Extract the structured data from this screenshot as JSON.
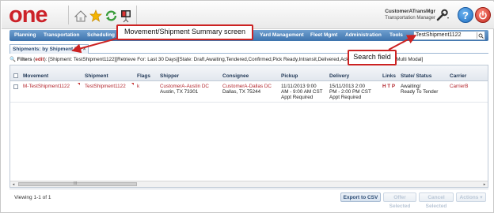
{
  "header": {
    "logo": "one",
    "user_name": "CustomerATransMgr",
    "user_role": "Transportation Manager",
    "help_label": "?",
    "icons": [
      "home-icon",
      "favorites-star-icon",
      "refresh-icon",
      "presentation-icon",
      "wrench-icon",
      "help-icon",
      "power-icon"
    ]
  },
  "nav": {
    "items": [
      "Planning",
      "Transportation",
      "Scheduling",
      "Yard Management",
      "Fleet Mgmt",
      "Administration",
      "Tools"
    ],
    "search_value": "TestShipment1122"
  },
  "tab": {
    "label": "Shipments: by Shipment No",
    "close": "×"
  },
  "filters": {
    "label": "Filters",
    "edit": "edit",
    "text": "[Shipment: TestShipment1122][Retrieve For: Last 30 Days][State: Draft,Awaiting,Tendered,Confirmed,Pick Ready,Intransit,Delivered,Acknowledged,Allocated,Multi Modal]"
  },
  "grid": {
    "columns": [
      "Movement",
      "Shipment",
      "Flags",
      "Shipper",
      "Consignee",
      "Pickup",
      "Delivery",
      "Links",
      "State/ Status",
      "Carrier"
    ],
    "rows": [
      {
        "movement": "M-TestShipment1122",
        "shipment": "TestShipment1122",
        "flags": "k",
        "shipper_name": "CustomerA-Austin DC",
        "shipper_city": "Austin, TX 73301",
        "consignee_name": "CustomerA-Dallas DC",
        "consignee_city": "Dallas, TX 75244",
        "pickup_1": "11/11/2013 9:00",
        "pickup_2": "AM - 9:00 AM CST",
        "pickup_3": "Appt Required",
        "delivery_1": "15/11/2013 2:00",
        "delivery_2": "PM - 2:00 PM CST",
        "delivery_3": "Appt Required",
        "links": "H T P",
        "state_1": "Awaiting/",
        "state_2": "Ready To Tender",
        "carrier": "CarrierB"
      }
    ],
    "scroll_marker": "III"
  },
  "footer": {
    "viewing": "Viewing 1-1 of 1",
    "export_label": "Export to CSV",
    "btn_offer": "Offer Selected",
    "btn_cancel": "Cancel Selected",
    "btn_actions": "Actions ▾"
  },
  "callouts": {
    "summary": "Movement/Shipment Summary screen",
    "search": "Search field"
  },
  "colors": {
    "brand_red": "#cc2229",
    "nav_blue": "#3d73ad",
    "link_red": "#b3262d",
    "callout_border": "#cc2222"
  }
}
